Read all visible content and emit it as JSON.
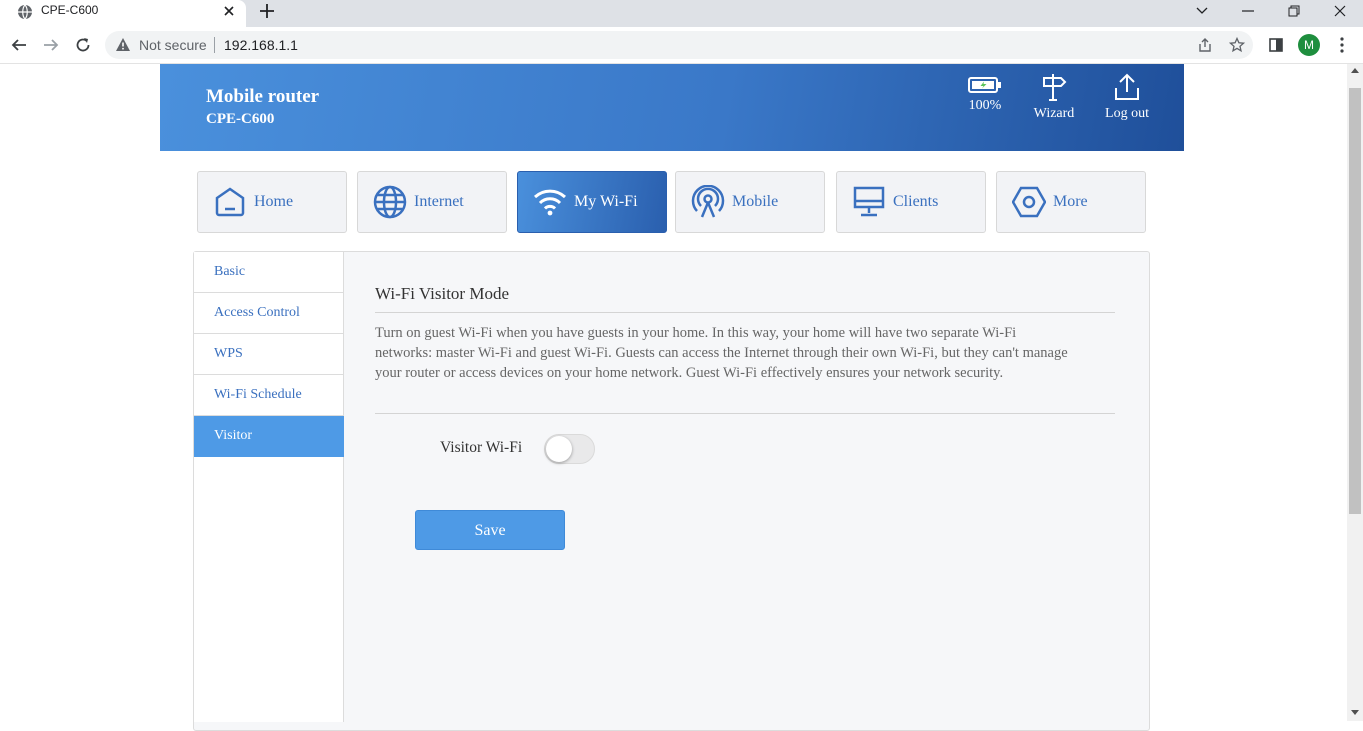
{
  "browser": {
    "tab_title": "CPE-C600",
    "security_label": "Not secure",
    "url": "192.168.1.1",
    "profile_initial": "M"
  },
  "header": {
    "brand_line1": "Mobile router",
    "brand_line2": "CPE-C600",
    "battery": {
      "label": "100%",
      "level": 1.0
    },
    "wizard_label": "Wizard",
    "logout_label": "Log out"
  },
  "nav": {
    "tabs": [
      {
        "label": "Home",
        "icon": "home-icon"
      },
      {
        "label": "Internet",
        "icon": "globe-icon"
      },
      {
        "label": "My Wi-Fi",
        "icon": "wifi-icon",
        "active": true
      },
      {
        "label": "Mobile",
        "icon": "antenna-icon"
      },
      {
        "label": "Clients",
        "icon": "monitor-icon"
      },
      {
        "label": "More",
        "icon": "hexagon-icon"
      }
    ]
  },
  "sidebar": {
    "items": [
      {
        "label": "Basic"
      },
      {
        "label": "Access Control"
      },
      {
        "label": "WPS"
      },
      {
        "label": "Wi-Fi Schedule"
      },
      {
        "label": "Visitor",
        "active": true
      }
    ]
  },
  "main": {
    "title": "Wi-Fi Visitor Mode",
    "description": "Turn on guest Wi-Fi when you have guests in your home. In this way, your home will have two separate Wi-Fi networks: master Wi-Fi and guest Wi-Fi. Guests can access the Internet through their own Wi-Fi, but they can't manage your router or access devices on your home network. Guest Wi-Fi effectively ensures your network security.",
    "visitor_wifi_label": "Visitor Wi-Fi",
    "visitor_wifi_enabled": false,
    "save_label": "Save"
  },
  "colors": {
    "accent": "#4e9ae6",
    "header_start": "#4a90dc",
    "header_end": "#1f4f9a",
    "nav_text": "#3a70bf"
  }
}
